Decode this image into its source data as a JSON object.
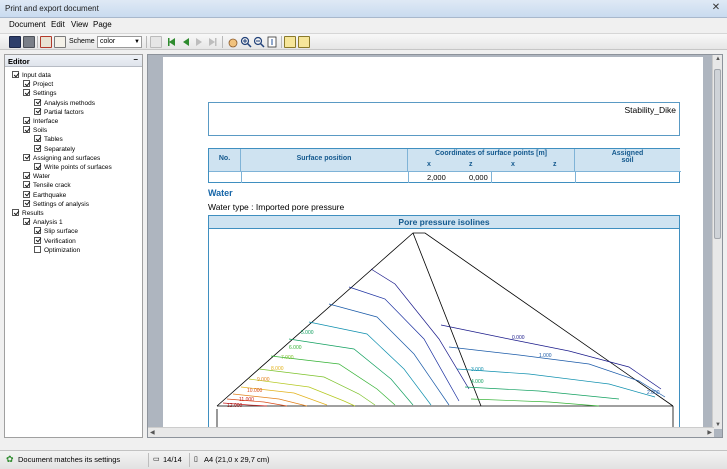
{
  "window": {
    "title": "Print and export document"
  },
  "menu": [
    "Document",
    "Edit",
    "View",
    "Page"
  ],
  "toolbar": {
    "scheme_label": "Scheme :",
    "scheme_value": "color"
  },
  "editor": {
    "title": "Editor",
    "items": [
      {
        "label": "Input data",
        "level": 0,
        "checked": true
      },
      {
        "label": "Project",
        "level": 1,
        "checked": true
      },
      {
        "label": "Settings",
        "level": 1,
        "checked": true
      },
      {
        "label": "Analysis methods",
        "level": 2,
        "checked": true
      },
      {
        "label": "Partial factors",
        "level": 2,
        "checked": true
      },
      {
        "label": "Interface",
        "level": 1,
        "checked": true
      },
      {
        "label": "Soils",
        "level": 1,
        "checked": true
      },
      {
        "label": "Tables",
        "level": 2,
        "checked": true
      },
      {
        "label": "Separately",
        "level": 2,
        "checked": true
      },
      {
        "label": "Assigning and surfaces",
        "level": 1,
        "checked": true
      },
      {
        "label": "Write points of surfaces",
        "level": 2,
        "checked": true
      },
      {
        "label": "Water",
        "level": 1,
        "checked": true
      },
      {
        "label": "Tensile crack",
        "level": 1,
        "checked": true
      },
      {
        "label": "Earthquake",
        "level": 1,
        "checked": true
      },
      {
        "label": "Settings of analysis",
        "level": 1,
        "checked": true
      },
      {
        "label": "Results",
        "level": 0,
        "checked": true
      },
      {
        "label": "Analysis 1",
        "level": 1,
        "checked": true
      },
      {
        "label": "Slip surface",
        "level": 2,
        "checked": true
      },
      {
        "label": "Verification",
        "level": 2,
        "checked": true
      },
      {
        "label": "Optimization",
        "level": 2,
        "checked": false
      }
    ]
  },
  "document": {
    "project_name": "Stability_Dike",
    "table": {
      "col_no": "No.",
      "col_surface": "Surface position",
      "col_coords": "Coordinates of surface points [m]",
      "sub_x": "x",
      "sub_z": "z",
      "col_soil_1": "Assigned",
      "col_soil_2": "soil",
      "x_value": "2,000",
      "z_value": "0,000"
    },
    "water_heading": "Water",
    "water_type_label": "Water type :",
    "water_type_value": "Imported pore pressure",
    "isolines_title": "Pore pressure isolines",
    "isoline_labels": [
      "0.000",
      "1.000",
      "2.000",
      "3.000",
      "4.000",
      "5.000",
      "6.000",
      "7.000",
      "8.000",
      "9.000",
      "10.000",
      "11.000",
      "12.000"
    ]
  },
  "status": {
    "message": "Document matches its settings",
    "page": "14/14",
    "paper": "A4 (21,0 x 29,7 cm)"
  }
}
